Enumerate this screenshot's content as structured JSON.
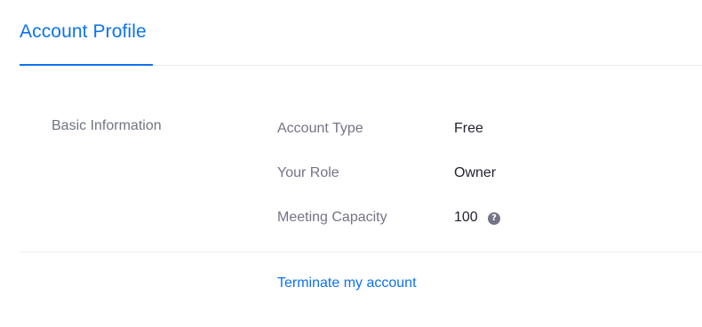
{
  "tabs": {
    "active_label": "Account Profile"
  },
  "section": {
    "title": "Basic Information",
    "rows": [
      {
        "label": "Account Type",
        "value": "Free"
      },
      {
        "label": "Your Role",
        "value": "Owner"
      },
      {
        "label": "Meeting Capacity",
        "value": "100",
        "icon": "help-icon"
      }
    ]
  },
  "actions": {
    "terminate_label": "Terminate my account"
  },
  "colors": {
    "accent": "#0e72ed",
    "label_text": "#747487",
    "value_text": "#232333",
    "divider": "#ededf0"
  }
}
